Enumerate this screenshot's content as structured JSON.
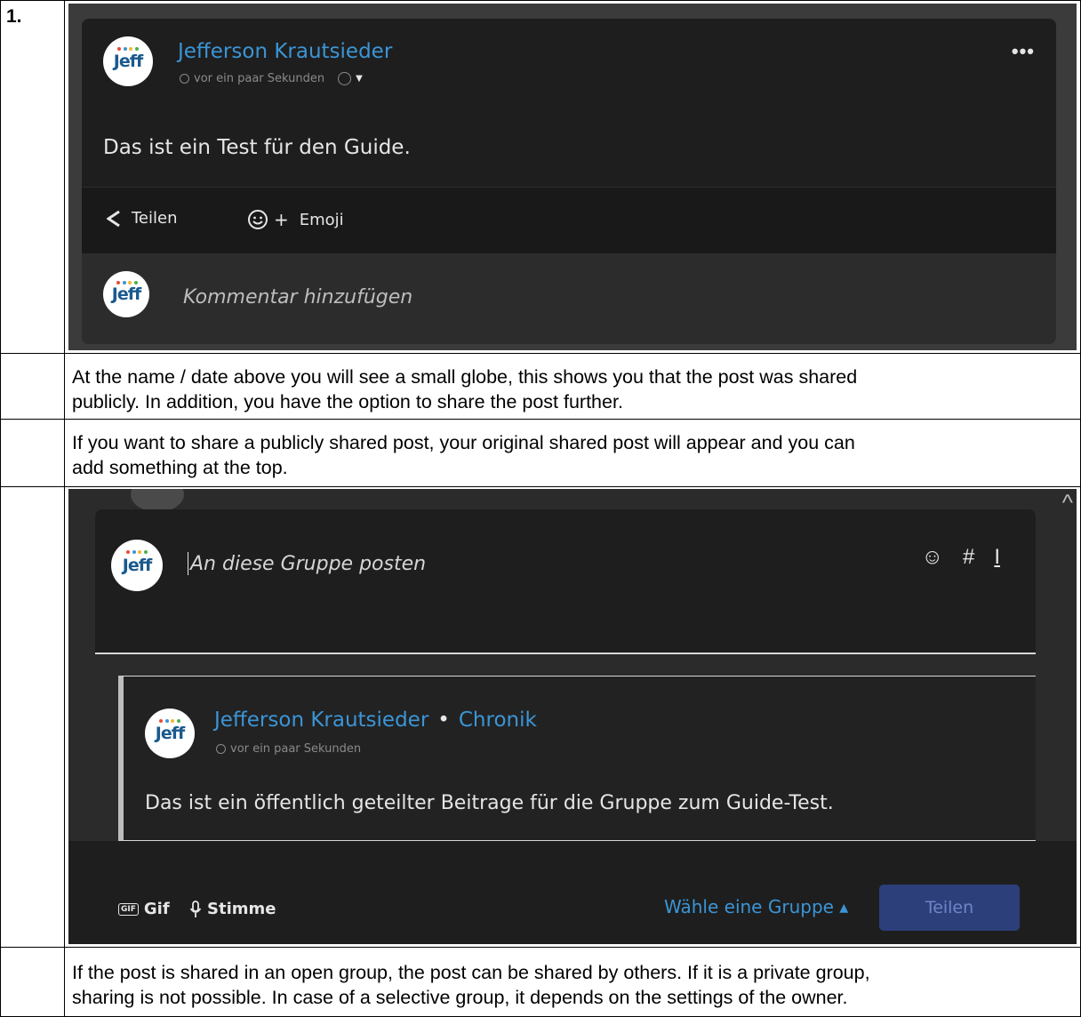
{
  "rows": [
    {
      "number": "1."
    },
    {
      "number": "",
      "text": [
        "At the name / date above you will see a small globe, this shows you that the post was shared",
        "publicly. In addition, you have the option to share the post further."
      ]
    },
    {
      "number": "",
      "text": [
        "If you want to share a publicly shared post, your original shared post will appear and you can",
        "add something at the top."
      ]
    },
    {
      "number": ""
    },
    {
      "number": "",
      "text": [
        "If the post is shared in an open group, the post can be shared by others. If it is a private group,",
        "sharing is not possible. In case of a selective group, it depends on the settings of the owner."
      ]
    }
  ],
  "screenshot1": {
    "avatar_text": "Jeff",
    "author": "Jefferson Krautsieder",
    "time": "vor ein paar Sekunden",
    "post_text": "Das ist ein Test für den Guide.",
    "more": "•••",
    "share_label": "Teilen",
    "emoji_label": "Emoji",
    "comment_placeholder": "Kommentar hinzufügen"
  },
  "screenshot2": {
    "composer_placeholder": "An diese Gruppe posten",
    "shared_author": "Jefferson Krautsieder",
    "shared_separator": "•",
    "shared_target": "Chronik",
    "shared_time": "vor ein paar Sekunden",
    "shared_text": "Das ist ein öffentlich geteilter Beitrage für die Gruppe zum Guide-Test.",
    "gif_badge": "GIF",
    "gif_label": "Gif",
    "voice_label": "Stimme",
    "group_select": "Wähle eine Gruppe ▴",
    "share_button": "Teilen"
  },
  "colors": {
    "link_blue": "#3b95d6",
    "dark_card": "#1e1e1e",
    "button_blue": "#2c3f7a"
  }
}
